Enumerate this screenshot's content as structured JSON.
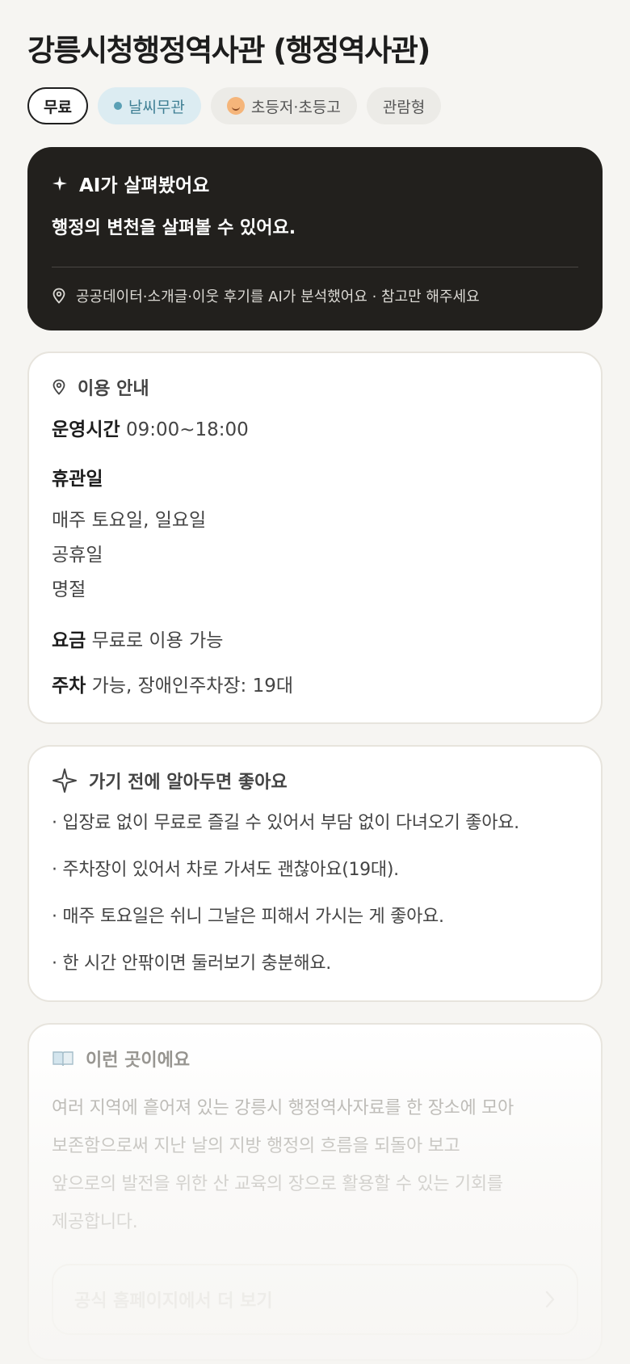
{
  "title": "강릉시청행정역사관 (행정역사관)",
  "tags": {
    "free": "무료",
    "weather": "날씨무관",
    "age": "초등저·초등고",
    "type": "관람형"
  },
  "ai_card": {
    "heading": "AI가 살펴봤어요",
    "summary": "행정의 변천을 살펴볼 수 있어요.",
    "footer": "공공데이터·소개글·이웃 후기를 AI가 분석했어요 · 참고만 해주세요"
  },
  "usage": {
    "heading": "이용 안내",
    "hours_label": "운영시간",
    "hours_value": "09:00~18:00",
    "closed_label": "휴관일",
    "closed_days": [
      "매주 토요일, 일요일",
      "공휴일",
      "명절"
    ],
    "fee_label": "요금",
    "fee_value": "무료로 이용 가능",
    "parking_label": "주차",
    "parking_value": "가능, 장애인주차장: 19대"
  },
  "tips": {
    "heading": "가기 전에 알아두면 좋아요",
    "items": [
      "· 입장료 없이 무료로 즐길 수 있어서 부담 없이 다녀오기 좋아요.",
      "· 주차장이 있어서 차로 가셔도 괜찮아요(19대).",
      "· 매주 토요일은 쉬니 그날은 피해서 가시는 게 좋아요.",
      "· 한 시간 안팎이면 둘러보기 충분해요."
    ]
  },
  "about": {
    "heading": "이런 곳이에요",
    "lines": [
      "여러 지역에 흩어져 있는 강릉시 행정역사자료를 한 장소에 모아",
      "보존함으로써 지난 날의 지방 행정의 흐름을 되돌아 보고",
      "앞으로의 발전을 위한 산 교육의 장으로 활용할 수 있는 기회를",
      "제공합니다."
    ],
    "more_button": "공식 홈페이지에서 더 보기"
  },
  "icons": {
    "ai_heading": "sparkle-icon",
    "ai_footer": "location-pin-icon",
    "usage": "location-pin-icon",
    "tips": "sparkle-outline-icon",
    "about": "open-book-icon",
    "more": "chevron-right-icon"
  }
}
